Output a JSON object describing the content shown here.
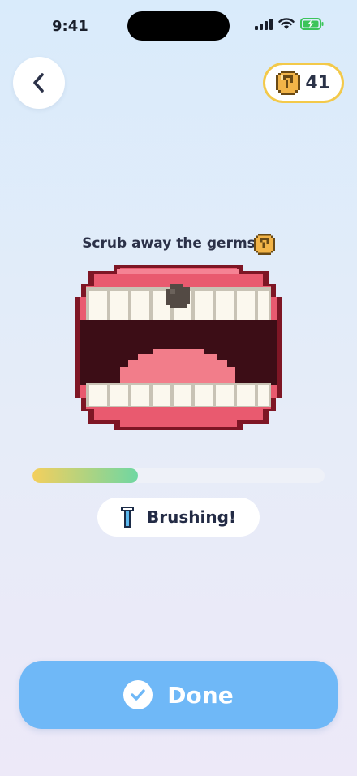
{
  "status_bar": {
    "time": "9:41"
  },
  "header": {
    "back_icon": "chevron-left-icon",
    "coins": {
      "icon": "coin-icon",
      "count": "41"
    }
  },
  "game": {
    "prompt": "Scrub away the germs",
    "prompt_icon": "coin-icon",
    "progress": 0.36,
    "status_icon": "toothbrush-icon",
    "status_text": "Brushing!"
  },
  "footer": {
    "done_icon": "check-icon",
    "done_label": "Done"
  },
  "colors": {
    "accent": "#6fb8f7",
    "coin_border": "#f3c94a",
    "gum": "#e95a6f",
    "tongue": "#f27d8a",
    "mouth_inside": "#3c0d16",
    "tooth": "#fbf8ee"
  }
}
